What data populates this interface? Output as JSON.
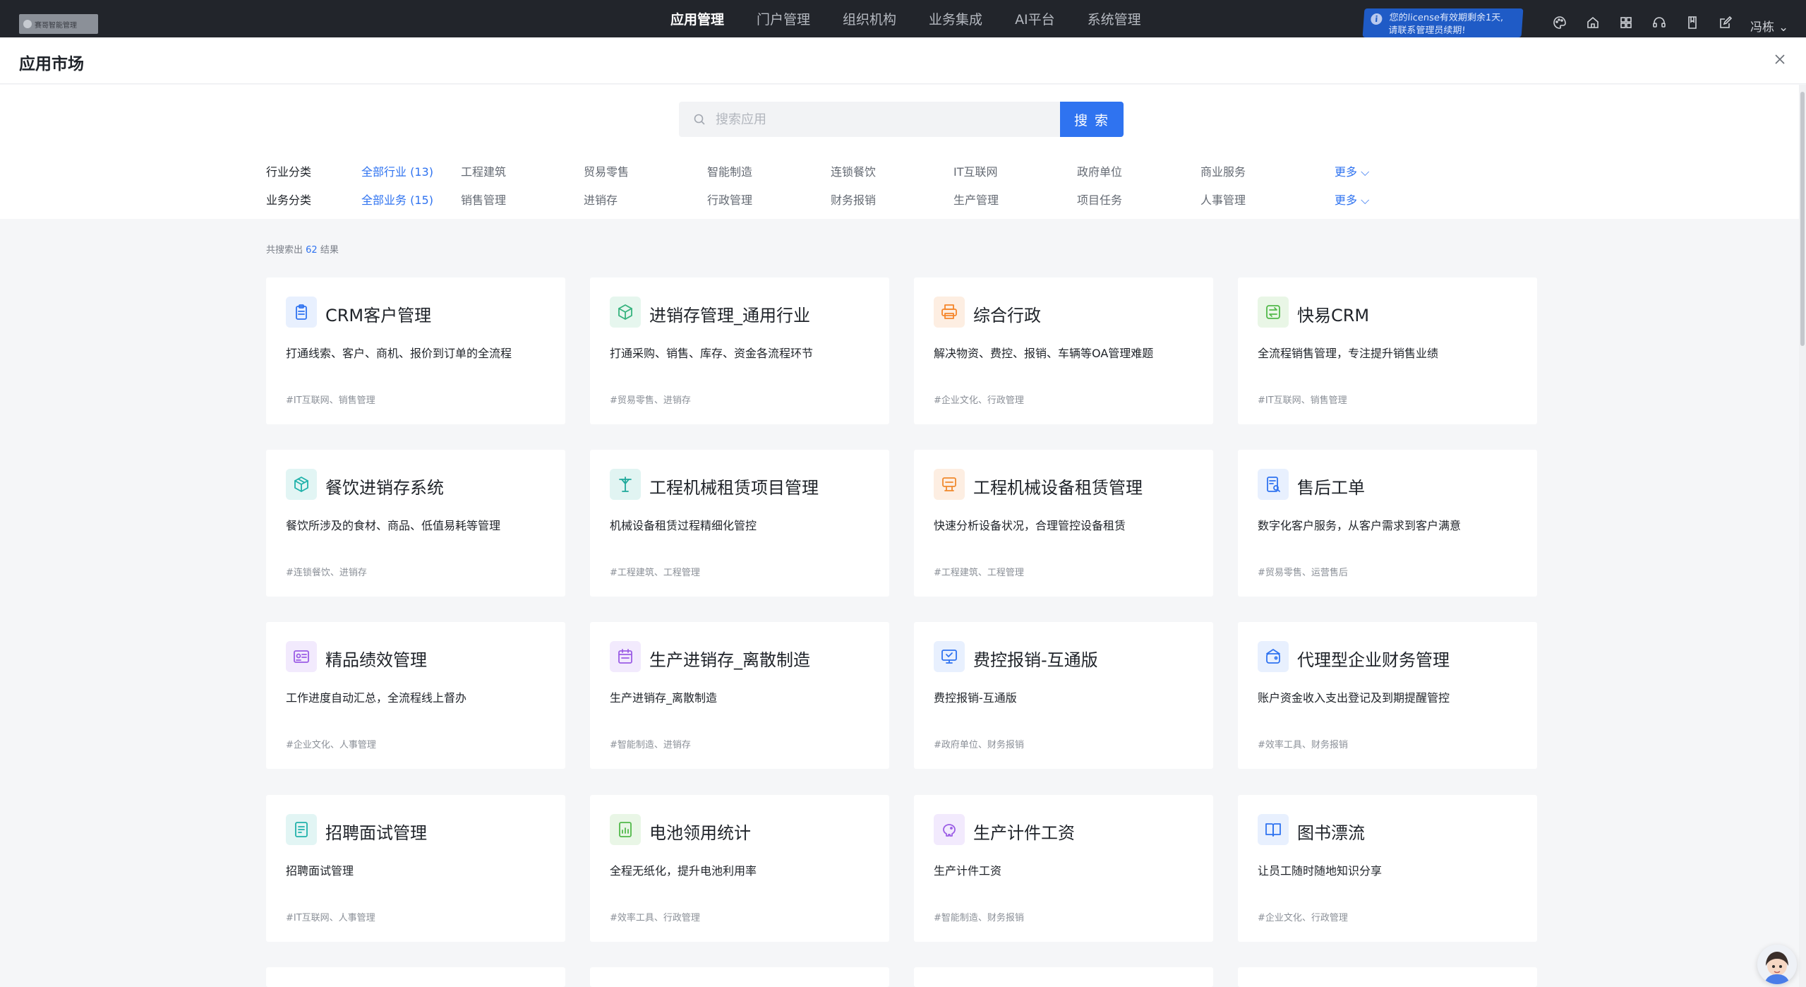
{
  "topbar": {
    "logo_text": "赛哥智能管理",
    "nav": [
      {
        "label": "应用管理",
        "active": true
      },
      {
        "label": "门户管理",
        "active": false
      },
      {
        "label": "组织机构",
        "active": false
      },
      {
        "label": "业务集成",
        "active": false
      },
      {
        "label": "AI平台",
        "active": false
      },
      {
        "label": "系统管理",
        "active": false
      }
    ],
    "license_line1": "您的license有效期剩余1天,",
    "license_line2": "请联系管理员续期!",
    "icons": [
      "palette-icon",
      "home-icon",
      "grid-icon",
      "headset-icon",
      "book-icon",
      "edit-icon"
    ],
    "user_name": "冯栋"
  },
  "header": {
    "title": "应用市场"
  },
  "search": {
    "placeholder": "搜索应用",
    "button_label": "搜 索"
  },
  "filters": {
    "industry": {
      "label": "行业分类",
      "options": [
        "全部行业 (13)",
        "工程建筑",
        "贸易零售",
        "智能制造",
        "连锁餐饮",
        "IT互联网",
        "政府单位",
        "商业服务"
      ],
      "more": "更多"
    },
    "business": {
      "label": "业务分类",
      "options": [
        "全部业务 (15)",
        "销售管理",
        "进销存",
        "行政管理",
        "财务报销",
        "生产管理",
        "项目任务",
        "人事管理"
      ],
      "more": "更多"
    }
  },
  "results": {
    "prefix": "共搜索出",
    "count": "62",
    "suffix": "结果"
  },
  "apps": [
    {
      "title": "CRM客户管理",
      "desc": "打通线索、客户、商机、报价到订单的全流程",
      "tags": "#IT互联网、销售管理",
      "icon": "clipboard-icon",
      "color": "#2f73f0",
      "bg": "#e8f0fe"
    },
    {
      "title": "进销存管理_通用行业",
      "desc": "打通采购、销售、库存、资金各流程环节",
      "tags": "#贸易零售、进销存",
      "icon": "cube-icon",
      "color": "#36b37e",
      "bg": "#e6f6ee"
    },
    {
      "title": "综合行政",
      "desc": "解决物资、费控、报销、车辆等OA管理难题",
      "tags": "#企业文化、行政管理",
      "icon": "printer-icon",
      "color": "#f5862b",
      "bg": "#fdeee2"
    },
    {
      "title": "快易CRM",
      "desc": "全流程销售管理，专注提升销售业绩",
      "tags": "#IT互联网、销售管理",
      "icon": "exchange-icon",
      "color": "#52b94a",
      "bg": "#e9f6e6"
    },
    {
      "title": "餐饮进销存系统",
      "desc": "餐饮所涉及的食材、商品、低值易耗等管理",
      "tags": "#连锁餐饮、进销存",
      "icon": "box-icon",
      "color": "#20b2aa",
      "bg": "#e2f5f4"
    },
    {
      "title": "工程机械租赁项目管理",
      "desc": "机械设备租赁过程精细化管控",
      "tags": "#工程建筑、工程管理",
      "icon": "crane-icon",
      "color": "#1fa99b",
      "bg": "#e1f4f2"
    },
    {
      "title": "工程机械设备租赁管理",
      "desc": "快速分析设备状况，合理管控设备租赁",
      "tags": "#工程建筑、工程管理",
      "icon": "machine-icon",
      "color": "#f0892d",
      "bg": "#fdeee2"
    },
    {
      "title": "售后工单",
      "desc": "数字化客户服务，从客户需求到客户满意",
      "tags": "#贸易零售、运营售后",
      "icon": "ticket-icon",
      "color": "#2f73f0",
      "bg": "#e8f0fe"
    },
    {
      "title": "精品绩效管理",
      "desc": "工作进度自动汇总，全流程线上督办",
      "tags": "#企业文化、人事管理",
      "icon": "id-card-icon",
      "color": "#9b5de5",
      "bg": "#f2eafd"
    },
    {
      "title": "生产进销存_离散制造",
      "desc": "生产进销存_离散制造",
      "tags": "#智能制造、进销存",
      "icon": "calendar-icon",
      "color": "#9b5de5",
      "bg": "#f2eafd"
    },
    {
      "title": "费控报销-互通版",
      "desc": "费控报销-互通版",
      "tags": "#政府单位、财务报销",
      "icon": "monitor-icon",
      "color": "#2f73f0",
      "bg": "#e8f0fe"
    },
    {
      "title": "代理型企业财务管理",
      "desc": "账户资金收入支出登记及到期提醒管控",
      "tags": "#效率工具、财务报销",
      "icon": "wallet-icon",
      "color": "#2f73f0",
      "bg": "#e8f0fe"
    },
    {
      "title": "招聘面试管理",
      "desc": "招聘面试管理",
      "tags": "#IT互联网、人事管理",
      "icon": "resume-icon",
      "color": "#20b2aa",
      "bg": "#e2f5f4"
    },
    {
      "title": "电池领用统计",
      "desc": "全程无纸化，提升电池利用率",
      "tags": "#效率工具、行政管理",
      "icon": "report-icon",
      "color": "#52b94a",
      "bg": "#e9f6e6"
    },
    {
      "title": "生产计件工资",
      "desc": "生产计件工资",
      "tags": "#智能制造、财务报销",
      "icon": "piggy-icon",
      "color": "#9b5de5",
      "bg": "#f2eafd"
    },
    {
      "title": "图书漂流",
      "desc": "让员工随时随地知识分享",
      "tags": "#企业文化、行政管理",
      "icon": "open-book-icon",
      "color": "#2f73f0",
      "bg": "#e8f0fe"
    }
  ]
}
